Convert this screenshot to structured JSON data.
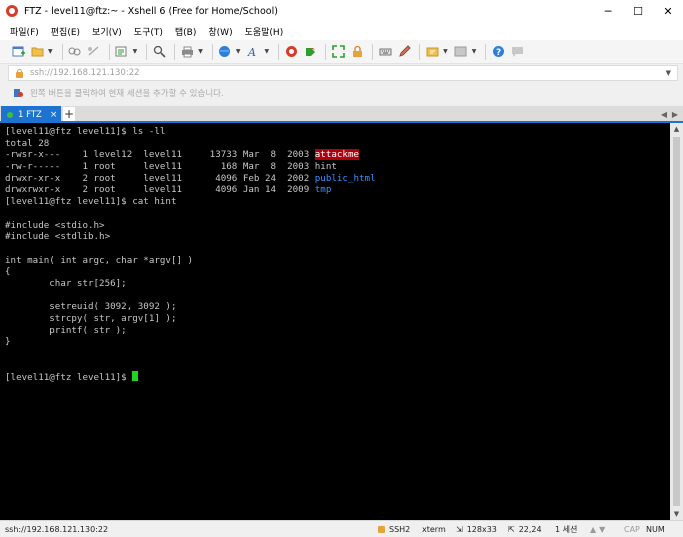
{
  "window": {
    "title": "FTZ - level11@ftz:~ - Xshell 6 (Free for Home/School)",
    "minimize": "─",
    "maximize": "☐",
    "close": "✕"
  },
  "menu": [
    "파일(F)",
    "편집(E)",
    "보기(V)",
    "도구(T)",
    "탭(B)",
    "창(W)",
    "도움말(H)"
  ],
  "address": {
    "value": "ssh://192.168.121.130:22",
    "hint": "왼쪽 버튼을 클릭하여 현재 세션을 추가할 수 있습니다."
  },
  "tabs": [
    {
      "label": "1 FTZ",
      "active": true,
      "close": "×"
    }
  ],
  "tab_add": "+",
  "terminal": {
    "prompt": "[level11@ftz level11]$ ",
    "lines": [
      {
        "text": "[level11@ftz level11]$ ls -ll"
      },
      {
        "text": "total 28"
      },
      {
        "text": "-rwsr-x---    1 level12  level11     13733 Mar  8  2003 ",
        "tail": "attackme",
        "style": "hl-red"
      },
      {
        "text": "-rw-r-----    1 root     level11       168 Mar  8  2003 ",
        "tail": "hint",
        "style": ""
      },
      {
        "text": "drwxr-xr-x    2 root     level11      4096 Feb 24  2002 ",
        "tail": "public_html",
        "style": "c-blue"
      },
      {
        "text": "drwxrwxr-x    2 root     level11      4096 Jan 14  2009 ",
        "tail": "tmp",
        "style": "c-blue"
      },
      {
        "text": "[level11@ftz level11]$ cat hint"
      },
      {
        "text": ""
      },
      {
        "text": "#include <stdio.h>"
      },
      {
        "text": "#include <stdlib.h>"
      },
      {
        "text": ""
      },
      {
        "text": "int main( int argc, char *argv[] )"
      },
      {
        "text": "{"
      },
      {
        "text": "        char str[256];"
      },
      {
        "text": ""
      },
      {
        "text": "        setreuid( 3092, 3092 );"
      },
      {
        "text": "        strcpy( str, argv[1] );"
      },
      {
        "text": "        printf( str );"
      },
      {
        "text": "}"
      },
      {
        "text": ""
      },
      {
        "text": ""
      }
    ]
  },
  "status": {
    "host": "ssh://192.168.121.130:22",
    "protocol": "SSH2",
    "term": "xterm",
    "size": "128x33",
    "cursor": "22,24",
    "sessions": "1 세션",
    "caps": "CAP",
    "num": "NUM"
  },
  "colors": {
    "terminal_bg": "#000000",
    "terminal_fg": "#c7c7c7",
    "highlight_red": "#b0000d",
    "dir_blue": "#3a8fff",
    "cursor_green": "#1fd51f",
    "tab_active": "#1e73d0"
  },
  "icons": {
    "app": "xshell-icon",
    "toolbar": [
      "new-session-icon",
      "open-folder-icon",
      "connect-icon",
      "disconnect-icon",
      "properties-icon",
      "find-icon",
      "print-icon",
      "color-scheme-icon",
      "font-icon",
      "xshell-logo-icon",
      "xftp-icon",
      "fullscreen-icon",
      "lock-icon",
      "keyboard-icon",
      "compose-icon",
      "script-icon",
      "layout-icon",
      "help-icon",
      "chat-icon"
    ]
  }
}
